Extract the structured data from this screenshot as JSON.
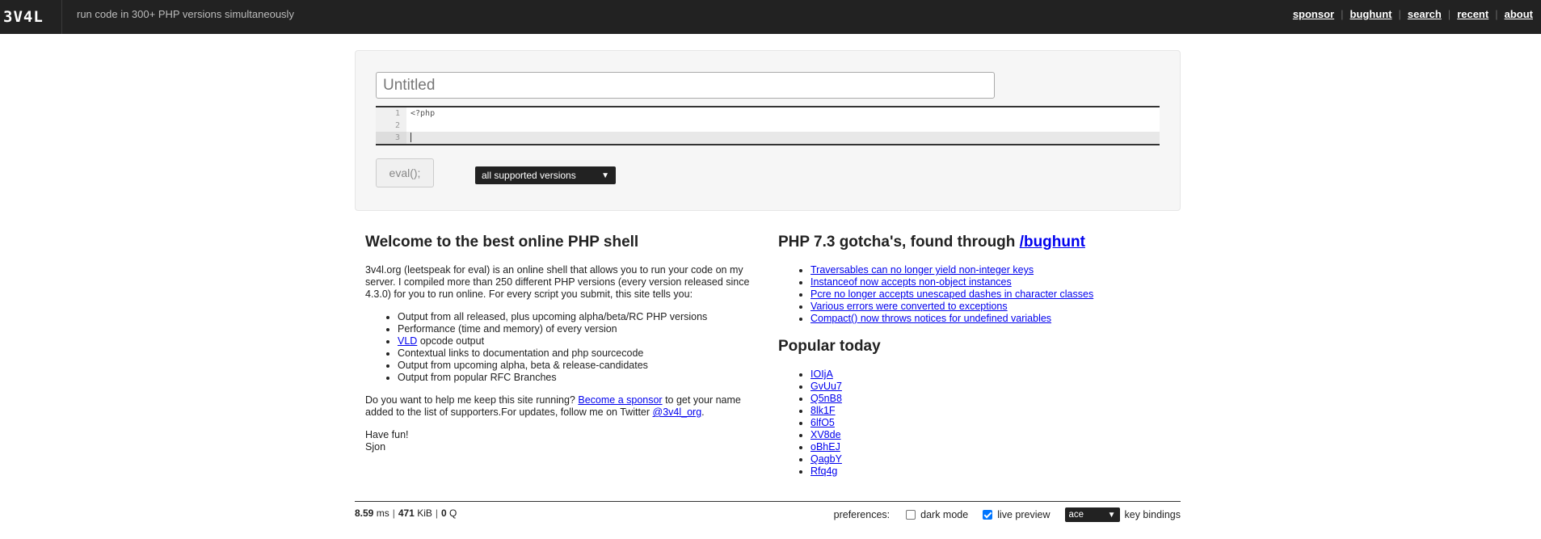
{
  "header": {
    "logo": "3V4L",
    "tagline": "run code in 300+ PHP versions simultaneously",
    "nav": [
      "sponsor",
      "bughunt",
      "search",
      "recent",
      "about"
    ]
  },
  "editor": {
    "title_placeholder": "Untitled",
    "lines": [
      {
        "num": "1",
        "text": "<?php"
      },
      {
        "num": "2",
        "text": ""
      },
      {
        "num": "3",
        "text": ""
      }
    ],
    "eval_label": "eval();",
    "version_selected": "all supported versions"
  },
  "welcome": {
    "heading": "Welcome to the best online PHP shell",
    "intro": "3v4l.org (leetspeak for eval) is an online shell that allows you to run your code on my server. I compiled more than 250 different PHP versions (every version released since 4.3.0) for you to run online. For every script you submit, this site tells you:",
    "features": [
      "Output from all released, plus upcoming alpha/beta/RC PHP versions",
      "Performance (time and memory) of every version",
      "opcode output",
      "Contextual links to documentation and php sourcecode",
      "Output from upcoming alpha, beta & release-candidates",
      "Output from popular RFC Branches"
    ],
    "vld_link": "VLD",
    "sponsor_pre": "Do you want to help me keep this site running? ",
    "sponsor_link": "Become a sponsor",
    "sponsor_post": " to get your name added to the list of supporters.For updates, follow me on Twitter ",
    "twitter_link": "@3v4l_org",
    "sponsor_end": ".",
    "have_fun": "Have fun!",
    "signature": "Sjon"
  },
  "gotchas": {
    "heading": "PHP 7.3 gotcha's, found through ",
    "heading_link": "/bughunt",
    "items": [
      "Traversables can no longer yield non-integer keys",
      "Instanceof now accepts non-object instances",
      "Pcre no longer accepts unescaped dashes in character classes",
      "Various errors were converted to exceptions",
      "Compact() now throws notices for undefined variables"
    ]
  },
  "popular": {
    "heading": "Popular today",
    "items": [
      "IOIjA",
      "GvUu7",
      "Q5nB8",
      "8lk1F",
      "6lfO5",
      "XV8de",
      "oBhEJ",
      "QagbY",
      "Rfq4g"
    ]
  },
  "footer": {
    "time_value": "8.59",
    "time_unit": " ms",
    "mem_value": "471",
    "mem_unit": " KiB",
    "queries_value": "0",
    "queries_unit": " Q",
    "prefs_label": "preferences:",
    "dark_mode": "dark mode",
    "dark_mode_checked": false,
    "live_preview": "live preview",
    "live_preview_checked": true,
    "key_bindings_value": "ace",
    "key_bindings_label": "key bindings"
  }
}
